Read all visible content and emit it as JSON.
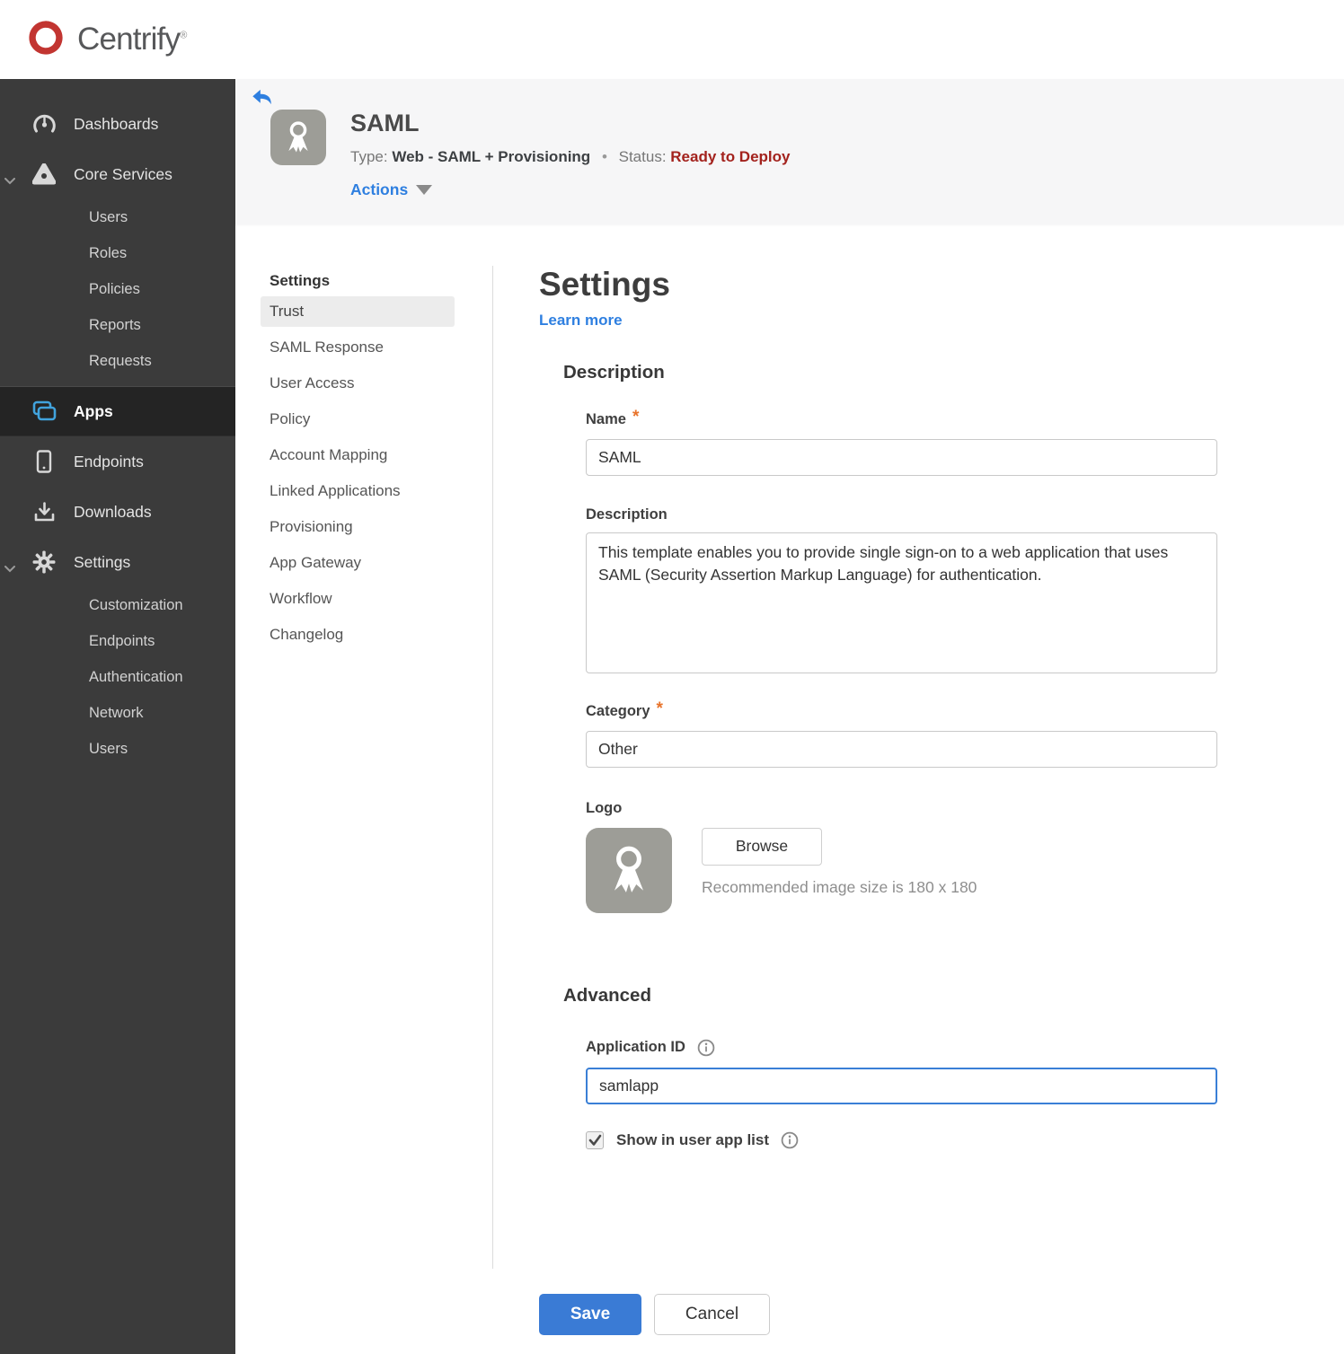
{
  "brand": {
    "name": "Centrify",
    "trademark": "®"
  },
  "sidebar": {
    "items": [
      {
        "label": "Dashboards"
      },
      {
        "label": "Core Services",
        "expanded": true,
        "children": [
          "Users",
          "Roles",
          "Policies",
          "Reports",
          "Requests"
        ]
      },
      {
        "label": "Apps",
        "active": true
      },
      {
        "label": "Endpoints"
      },
      {
        "label": "Downloads"
      },
      {
        "label": "Settings",
        "expanded": true,
        "children": [
          "Customization",
          "Endpoints",
          "Authentication",
          "Network",
          "Users"
        ]
      }
    ]
  },
  "header": {
    "app_title": "SAML",
    "type_label": "Type:",
    "type_value": "Web - SAML + Provisioning",
    "separator": "•",
    "status_label": "Status:",
    "status_value": "Ready to Deploy",
    "actions_label": "Actions"
  },
  "subnav": {
    "heading": "Settings",
    "selected": "Trust",
    "items": [
      "Trust",
      "SAML Response",
      "User Access",
      "Policy",
      "Account Mapping",
      "Linked Applications",
      "Provisioning",
      "App Gateway",
      "Workflow",
      "Changelog"
    ]
  },
  "main": {
    "title": "Settings",
    "learn_more": "Learn more",
    "description_section": {
      "heading": "Description",
      "name_label": "Name",
      "name_value": "SAML",
      "description_label": "Description",
      "description_value": "This template enables you to provide single sign-on to a web application that uses SAML (Security Assertion Markup Language) for authentication.",
      "category_label": "Category",
      "category_value": "Other",
      "logo_label": "Logo",
      "browse_label": "Browse",
      "logo_hint": "Recommended image size is 180 x 180"
    },
    "advanced_section": {
      "heading": "Advanced",
      "app_id_label": "Application ID",
      "app_id_value": "samlapp",
      "show_in_app_list_label": "Show in user app list",
      "checkbox_checked": true
    },
    "save_label": "Save",
    "cancel_label": "Cancel"
  },
  "colors": {
    "brand_red": "#c23531",
    "accent_blue": "#2e7fe0",
    "save_blue": "#3a7bd5",
    "status_red": "#a3221d",
    "apps_icon_blue": "#41a3dd",
    "sidebar_bg": "#3b3b3b",
    "sidebar_active_bg": "#242424",
    "app_badge_gray": "#9d9d97",
    "required_orange": "#e8732a"
  }
}
